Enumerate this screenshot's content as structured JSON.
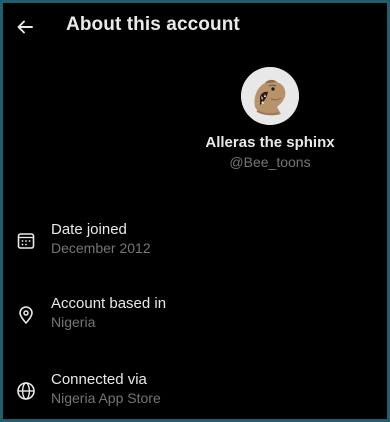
{
  "header": {
    "title": "About this account",
    "back_icon": "arrow-left-icon"
  },
  "profile": {
    "display_name": "Alleras the sphinx",
    "handle": "@Bee_toons",
    "avatar_image": "roaring big cat photo"
  },
  "details": [
    {
      "icon": "calendar-icon",
      "label": "Date joined",
      "value": "December 2012"
    },
    {
      "icon": "location-pin-icon",
      "label": "Account based in",
      "value": "Nigeria"
    },
    {
      "icon": "globe-icon",
      "label": "Connected via",
      "value": "Nigeria App Store"
    }
  ],
  "colors": {
    "background": "#000000",
    "frame_border": "#1f5f6e",
    "primary_text": "#e7e9ea",
    "secondary_text": "#71767b"
  }
}
